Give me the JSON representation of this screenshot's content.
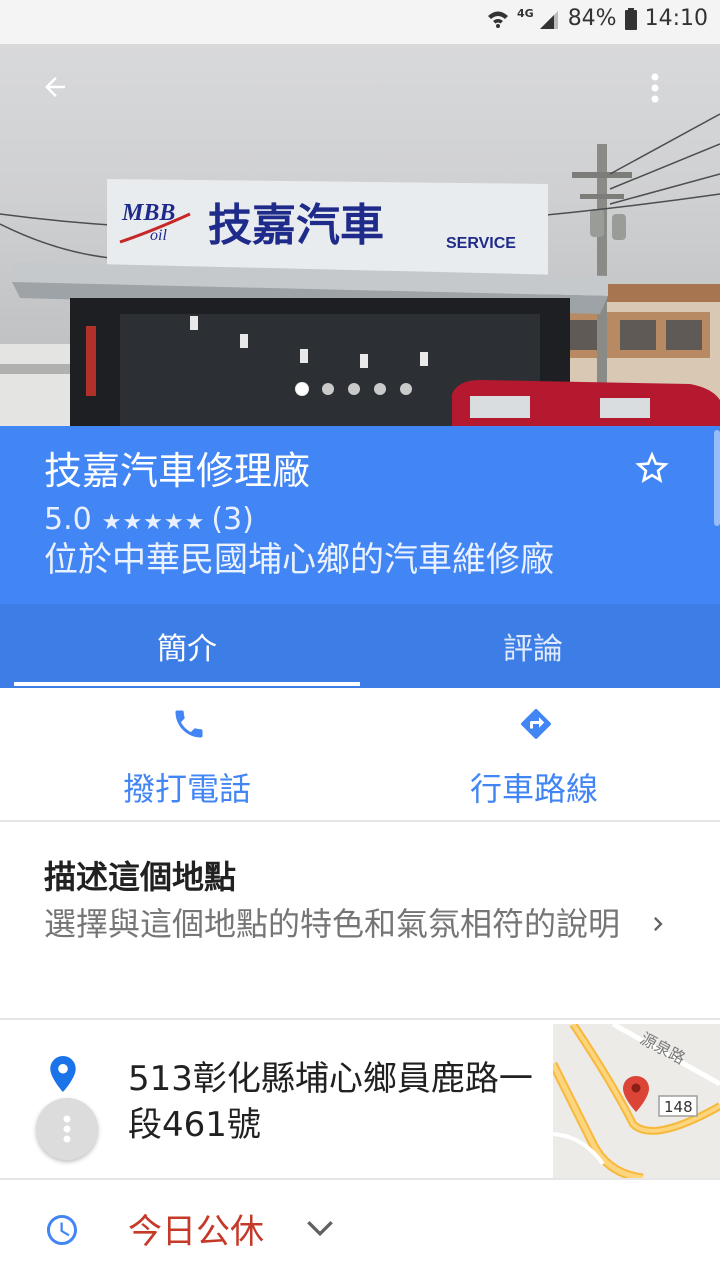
{
  "status_bar": {
    "network": "4G",
    "battery": "84%",
    "time": "14:10"
  },
  "photo": {
    "sign_brand": "MBB",
    "sign_brand_sub": "oil",
    "sign_name": "技嘉汽車",
    "sign_service": "SERVICE",
    "page_count": 5,
    "active_page": 1
  },
  "place": {
    "name": "技嘉汽車修理廠",
    "rating": "5.0",
    "stars": "★★★★★",
    "review_count": "(3)",
    "description": "位於中華民國埔心鄉的汽車維修廠"
  },
  "tabs": [
    {
      "label": "簡介",
      "active": true
    },
    {
      "label": "評論",
      "active": false
    }
  ],
  "actions": {
    "call_label": "撥打電話",
    "directions_label": "行車路線"
  },
  "describe": {
    "title": "描述這個地點",
    "subtitle": "選擇與這個地點的特色和氣氛相符的說明"
  },
  "address": {
    "text": "513彰化縣埔心鄉員鹿路一段461號",
    "map_road_label": "源泉路",
    "map_route_shield": "148"
  },
  "hours": {
    "text": "今日公休"
  },
  "colors": {
    "primary_blue": "#4285f4",
    "tab_blue": "#3d7de6",
    "closed_red": "#c53929",
    "pin_red": "#db4437"
  },
  "icons": {
    "back": "arrow-left-icon",
    "more": "more-vert-icon",
    "save": "star-outline-icon",
    "call": "phone-icon",
    "directions": "directions-icon",
    "chevron": "chevron-right-icon",
    "pin": "place-pin-icon",
    "clock": "clock-icon"
  }
}
